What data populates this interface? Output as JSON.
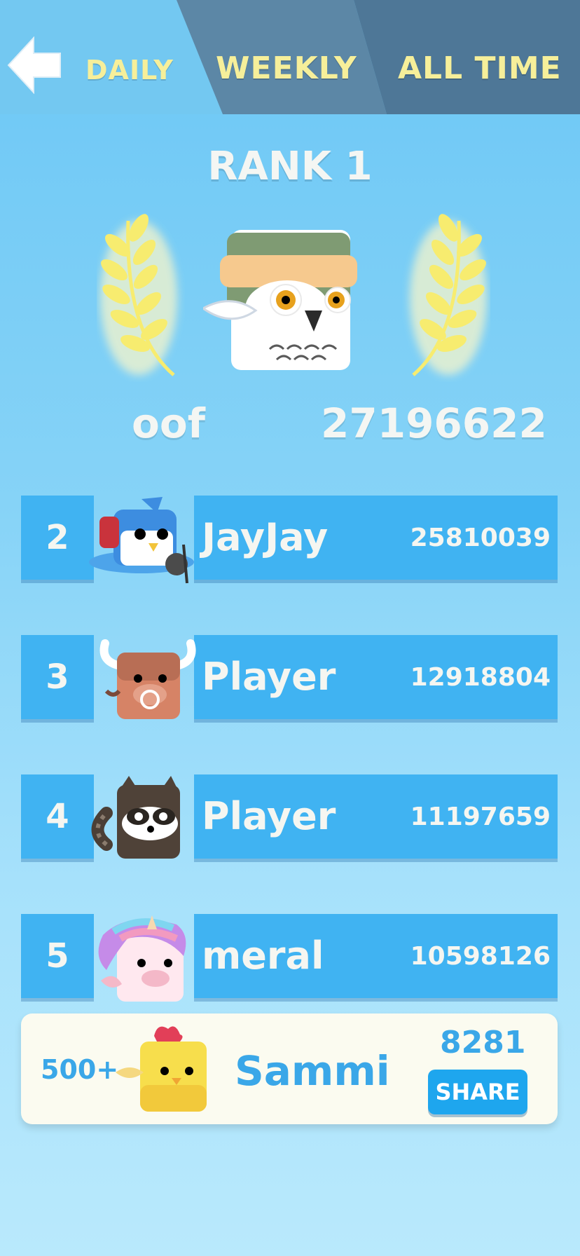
{
  "tabs": {
    "daily": "DAILY",
    "weekly": "WEEKLY",
    "all_time": "ALL TIME"
  },
  "champion": {
    "title": "RANK 1",
    "name": "oof",
    "score": "27196622"
  },
  "rows": [
    {
      "rank": "2",
      "name": "JayJay",
      "score": "25810039"
    },
    {
      "rank": "3",
      "name": "Player",
      "score": "12918804"
    },
    {
      "rank": "4",
      "name": "Player",
      "score": "11197659"
    },
    {
      "rank": "5",
      "name": "meral",
      "score": "10598126"
    }
  ],
  "me": {
    "rank": "500+",
    "name": "Sammi",
    "score": "8281",
    "share_label": "SHARE"
  },
  "colors": {
    "accent": "#40b3f2",
    "tab_text": "#f6ef9a",
    "card_text": "#3aa7e8"
  }
}
